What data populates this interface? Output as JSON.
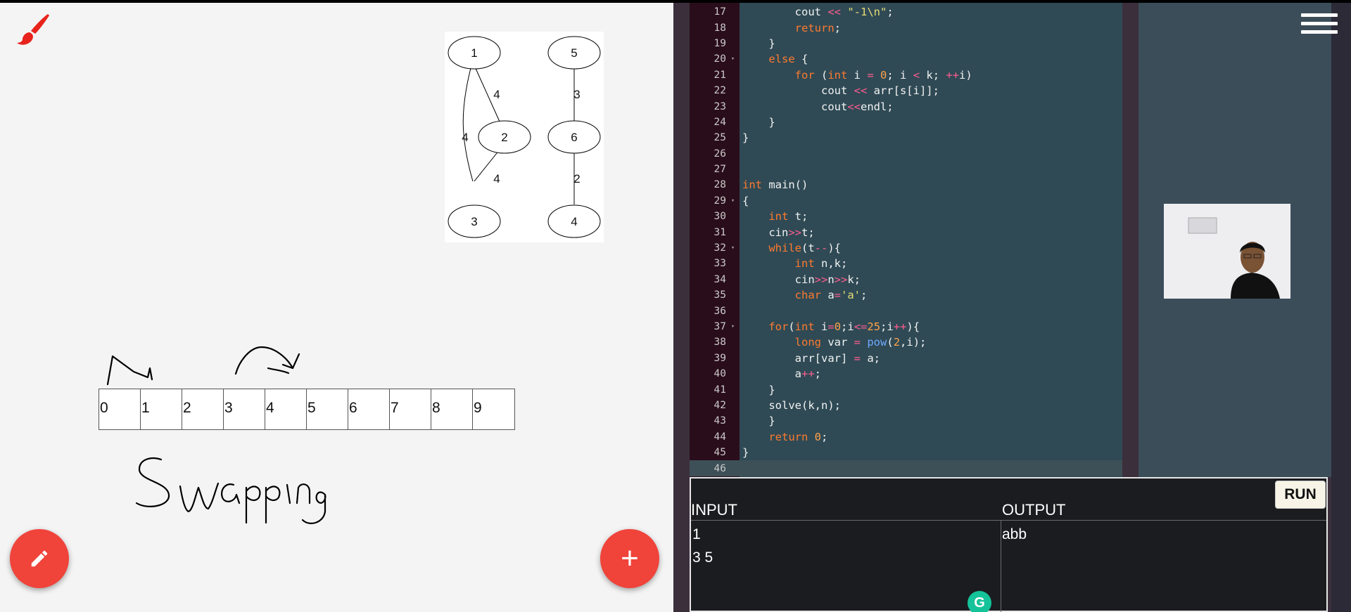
{
  "colors": {
    "accent": "#f0433a",
    "editor_bg": "#2f4a55",
    "io_bg": "#1b1c20"
  },
  "icons": {
    "brush": "paint-brush-icon",
    "pencil": "pencil-icon",
    "add": "plus-icon",
    "menu": "hamburger-menu-icon",
    "grammarly": "grammarly-icon"
  },
  "graph": {
    "nodes": [
      "1",
      "2",
      "3",
      "4",
      "5",
      "6"
    ],
    "edge_labels": [
      "4",
      "4",
      "4",
      "3",
      "2"
    ]
  },
  "array_cells": [
    "0",
    "1",
    "2",
    "3",
    "4",
    "5",
    "6",
    "7",
    "8",
    "9"
  ],
  "handwriting": "Swapping",
  "fab": {
    "add_label": "+"
  },
  "editor": {
    "lines": [
      {
        "n": "17",
        "fold": "",
        "html": "        <span class='fn2'>cout</span> <span class='op'>&lt;&lt;</span> <span class='str'>\"-1\\n\"</span>;"
      },
      {
        "n": "18",
        "fold": "",
        "html": "        <span class='kw'>return</span>;"
      },
      {
        "n": "19",
        "fold": "",
        "html": "    }"
      },
      {
        "n": "20",
        "fold": "▾",
        "html": "    <span class='kw'>else</span> {"
      },
      {
        "n": "21",
        "fold": "",
        "html": "        <span class='kw'>for</span> (<span class='kw'>int</span> i <span class='op'>=</span> <span class='num'>0</span>; i <span class='op'>&lt;</span> k; <span class='op'>++</span>i)"
      },
      {
        "n": "22",
        "fold": "",
        "html": "            cout <span class='op'>&lt;&lt;</span> arr[s[i]];"
      },
      {
        "n": "23",
        "fold": "",
        "html": "            cout<span class='op'>&lt;&lt;</span>endl;"
      },
      {
        "n": "24",
        "fold": "",
        "html": "    }"
      },
      {
        "n": "25",
        "fold": "",
        "html": "}"
      },
      {
        "n": "26",
        "fold": "",
        "html": ""
      },
      {
        "n": "27",
        "fold": "",
        "html": ""
      },
      {
        "n": "28",
        "fold": "",
        "html": "<span class='kw'>int</span> main()"
      },
      {
        "n": "29",
        "fold": "▾",
        "html": "{"
      },
      {
        "n": "30",
        "fold": "",
        "html": "    <span class='kw'>int</span> t;"
      },
      {
        "n": "31",
        "fold": "",
        "html": "    cin<span class='op'>&gt;&gt;</span>t;"
      },
      {
        "n": "32",
        "fold": "▾",
        "html": "    <span class='kw'>while</span>(t<span class='op'>--</span>){"
      },
      {
        "n": "33",
        "fold": "",
        "html": "        <span class='kw'>int</span> n,k;"
      },
      {
        "n": "34",
        "fold": "",
        "html": "        cin<span class='op'>&gt;&gt;</span>n<span class='op'>&gt;&gt;</span>k;"
      },
      {
        "n": "35",
        "fold": "",
        "html": "        <span class='kw'>char</span> a<span class='op'>=</span><span class='str'>'a'</span>;"
      },
      {
        "n": "36",
        "fold": "",
        "html": ""
      },
      {
        "n": "37",
        "fold": "▾",
        "html": "    <span class='kw'>for</span>(<span class='kw'>int</span> i<span class='op'>=</span><span class='num'>0</span>;i<span class='op'>&lt;=</span><span class='num'>25</span>;i<span class='op'>++</span>){"
      },
      {
        "n": "38",
        "fold": "",
        "html": "        <span class='kw'>long</span> var <span class='op'>=</span> <span class='fn'>pow</span>(<span class='num'>2</span>,i);"
      },
      {
        "n": "39",
        "fold": "",
        "html": "        arr[var] <span class='op'>=</span> a;"
      },
      {
        "n": "40",
        "fold": "",
        "html": "        a<span class='op'>++</span>;"
      },
      {
        "n": "41",
        "fold": "",
        "html": "    }"
      },
      {
        "n": "42",
        "fold": "",
        "html": "    solve(k,n);"
      },
      {
        "n": "43",
        "fold": "",
        "html": "    }"
      },
      {
        "n": "44",
        "fold": "",
        "html": "    <span class='kw'>return</span> <span class='num'>0</span>;"
      },
      {
        "n": "45",
        "fold": "",
        "html": "}"
      },
      {
        "n": "46",
        "fold": "",
        "html": ""
      }
    ]
  },
  "io": {
    "input_label": "INPUT",
    "output_label": "OUTPUT",
    "input_text": "1\n3 5",
    "output_text": "abb",
    "run_label": "RUN",
    "grammarly_letter": "G"
  }
}
